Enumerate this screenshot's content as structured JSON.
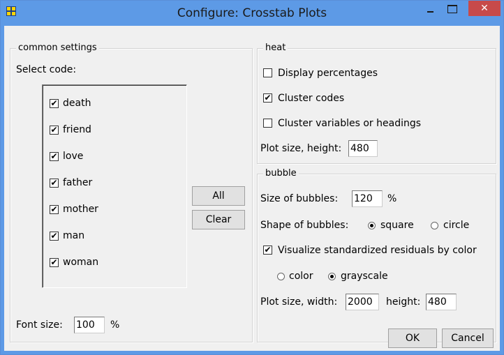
{
  "window": {
    "title": "Configure: Crosstab Plots",
    "close_glyph": "✕"
  },
  "common": {
    "legend": "common settings",
    "select_code_label": "Select code:",
    "codes": [
      {
        "label": "death",
        "checked": true
      },
      {
        "label": "friend",
        "checked": true
      },
      {
        "label": "love",
        "checked": true
      },
      {
        "label": "father",
        "checked": true
      },
      {
        "label": "mother",
        "checked": true
      },
      {
        "label": "man",
        "checked": true
      },
      {
        "label": "woman",
        "checked": true
      }
    ],
    "all_button": "All",
    "clear_button": "Clear",
    "font_size_label": "Font size:",
    "font_size_value": "100",
    "font_size_unit": "%"
  },
  "heat": {
    "legend": "heat",
    "display_percentages": {
      "label": "Display percentages",
      "checked": false
    },
    "cluster_codes": {
      "label": "Cluster codes",
      "checked": true
    },
    "cluster_variables": {
      "label": "Cluster variables or headings",
      "checked": false
    },
    "plot_height_label": "Plot size, height:",
    "plot_height_value": "480"
  },
  "bubble": {
    "legend": "bubble",
    "size_label": "Size of bubbles:",
    "size_value": "120",
    "size_unit": "%",
    "shape_label": "Shape of bubbles:",
    "shape_options": [
      {
        "label": "square",
        "selected": true
      },
      {
        "label": "circle",
        "selected": false
      }
    ],
    "residuals": {
      "label": "Visualize standardized residuals by color",
      "checked": true
    },
    "color_options": [
      {
        "label": "color",
        "selected": false
      },
      {
        "label": "grayscale",
        "selected": true
      }
    ],
    "plot_width_label": "Plot size, width:",
    "plot_width_value": "2000",
    "plot_height_label": "height:",
    "plot_height_value": "480"
  },
  "footer": {
    "ok_button": "OK",
    "cancel_button": "Cancel"
  },
  "check_glyph": "✔"
}
